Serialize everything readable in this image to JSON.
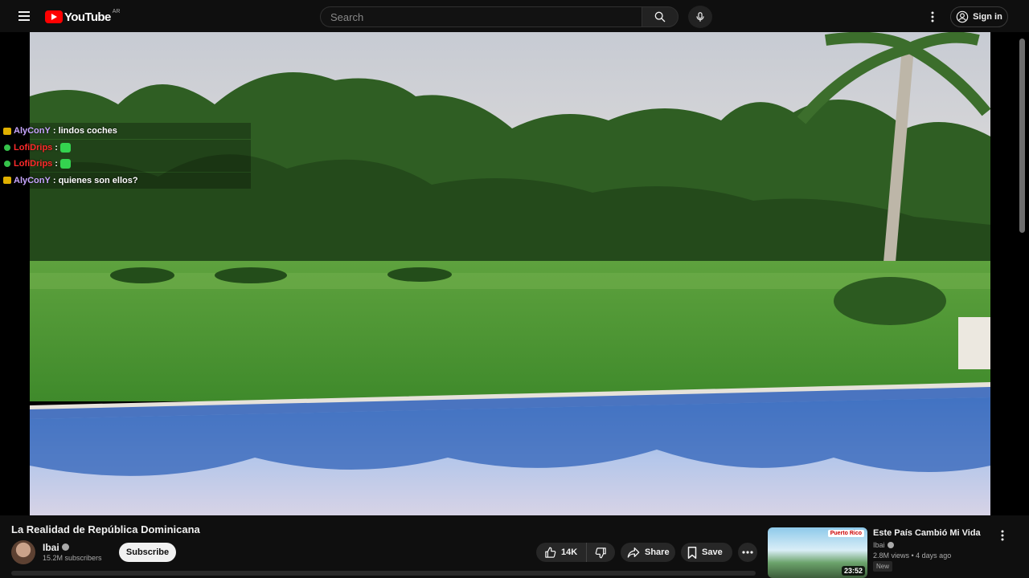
{
  "header": {
    "logo_text": "YouTube",
    "country_code": "AR",
    "search_placeholder": "Search",
    "signin_label": "Sign in"
  },
  "chat": [
    {
      "user": "AlyConY",
      "user_color": "#c8a6ff",
      "badge_color": "#e0b000",
      "message": ": lindos coches",
      "emote": false
    },
    {
      "user": "LofiDrips",
      "user_color": "#ff2b2b",
      "badge_color": "#35c24a",
      "message": ":",
      "emote": true
    },
    {
      "user": "LofiDrips",
      "user_color": "#ff2b2b",
      "badge_color": "#35c24a",
      "message": ":",
      "emote": true
    },
    {
      "user": "AlyConY",
      "user_color": "#c8a6ff",
      "badge_color": "#e0b000",
      "message": ": quienes son ellos?",
      "emote": false
    }
  ],
  "video": {
    "title": "La Realidad de República Dominicana",
    "channel": "Ibai",
    "subscribers": "15.2M subscribers",
    "subscribe_label": "Subscribe",
    "likes": "14K",
    "share_label": "Share",
    "save_label": "Save"
  },
  "recommended": {
    "title": "Este País Cambió Mi Vida",
    "channel": "Ibai",
    "meta": "2.8M views • 4 days ago",
    "badge": "New",
    "duration": "23:52",
    "thumb_tag": "Puerto Rico"
  },
  "colors": {
    "background": "#0f0f0f",
    "accent_red": "#ff0000",
    "signin_blue": "#3ea6ff",
    "pill": "#272727"
  }
}
